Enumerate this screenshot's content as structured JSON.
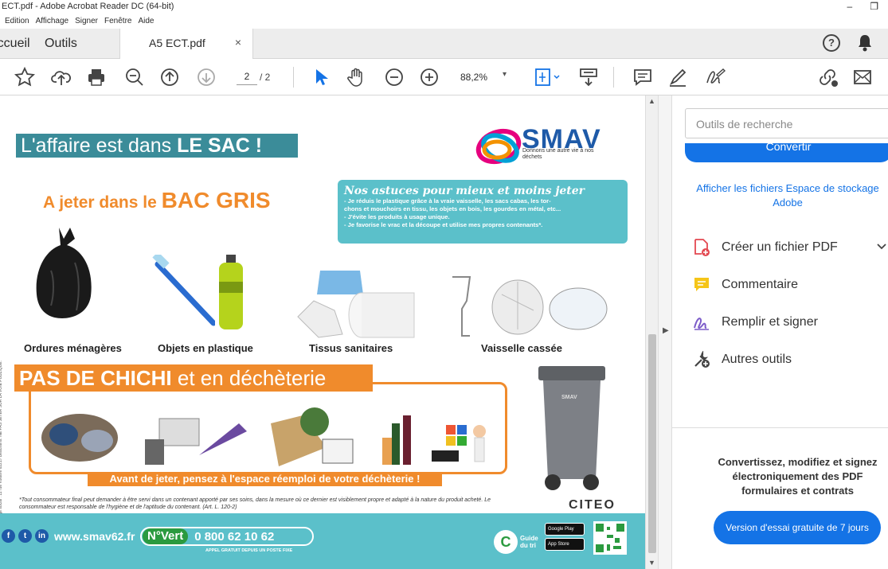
{
  "window": {
    "title": "ECT.pdf - Adobe Acrobat Reader DC (64-bit)",
    "minimize": "–",
    "restore": "❐"
  },
  "menu": [
    "Edition",
    "Affichage",
    "Signer",
    "Fenêtre",
    "Aide"
  ],
  "tabs": {
    "home": "Accueil",
    "tools": "Outils",
    "doc": "A5 ECT.pdf",
    "close": "×",
    "help": "?"
  },
  "toolbar": {
    "page_current": "2",
    "page_total": "/ 2",
    "zoom": "88,2%",
    "zoom_arrow": "▾"
  },
  "icons": [
    "star-icon",
    "upload-icon",
    "print-icon",
    "zoom-out-icon",
    "page-up-icon",
    "page-down-icon",
    "select-arrow-icon",
    "hand-icon",
    "minus-circle-icon",
    "plus-circle-icon",
    "fit-page-icon",
    "scroll-mode-icon",
    "comment-icon",
    "highlight-icon",
    "sign-icon",
    "link-icon",
    "mail-icon",
    "bell-icon"
  ],
  "colors": {
    "accent": "#1473e6",
    "orange": "#f08b2c",
    "teal": "#5bc0ca",
    "banner": "#3b8c99"
  },
  "document": {
    "side_text": "SMAV - Syndicat Mixte Artois Valorisation - Siège social : 11 rue Voltaire 62217 Beaurains. NE PAS JETER SUR LA VOIE PUBLIQUE.",
    "banner_prefix": "L'affaire est dans ",
    "banner_bold": "LE SAC !",
    "smav": "SMAV",
    "smav_tagline": "Donnons une autre vie à nos déchets",
    "bac_prefix": "A jeter dans le ",
    "bac_bold": "BAC GRIS",
    "tips_title": "Nos astuces pour mieux et moins jeter",
    "tips": [
      "- Je réduis le plastique grâce à la vraie vaisselle, les sacs cabas, les tor-",
      "  chons et mouchoirs en tissu, les objets en bois, les gourdes en métal, etc...",
      "- J'évite les produits à usage unique.",
      "- Je favorise le vrac et la découpe et utilise mes propres contenants*."
    ],
    "categories": [
      "Ordures ménagères",
      "Objets en plastique",
      "Tissus sanitaires",
      "Vaisselle cassée"
    ],
    "chichi_bold": "PAS DE CHICHI",
    "chichi_rest": " et en déchèterie",
    "reemploi": "Avant de jeter, pensez à l'espace réemploi de votre déchèterie !",
    "footnote": "*Tout consommateur final peut demander à être servi dans un contenant apporté par ses soins, dans la mesure où ce dernier est visiblement propre et adapté à la nature du produit acheté. Le consommateur est responsable de l'hygiène et de l'aptitude du contenant. (Art. L. 120-2)",
    "citeo": "CITEO",
    "bin_logo": "SMAV",
    "web": "www.smav62.fr",
    "social": [
      "f",
      "t",
      "in"
    ],
    "nvert": "N°Vert",
    "phone": "0 800 62 10 62",
    "phone_sub": "APPEL GRATUIT DEPUIS UN POSTE FIXE",
    "guide_letter": "C",
    "guide": "Guide du tri",
    "stores": [
      "Google Play",
      "App Store"
    ]
  },
  "panel": {
    "search_placeholder": "Outils de recherche",
    "convert": "Convertir",
    "storage_link": "Afficher les fichiers Espace de stockage Adobe",
    "items": [
      "Créer un fichier PDF",
      "Commentaire",
      "Remplir et signer",
      "Autres outils"
    ],
    "promo": "Convertissez, modifiez et signez électroniquement des PDF formulaires et contrats",
    "trial": "Version d'essai gratuite de 7 jours"
  }
}
